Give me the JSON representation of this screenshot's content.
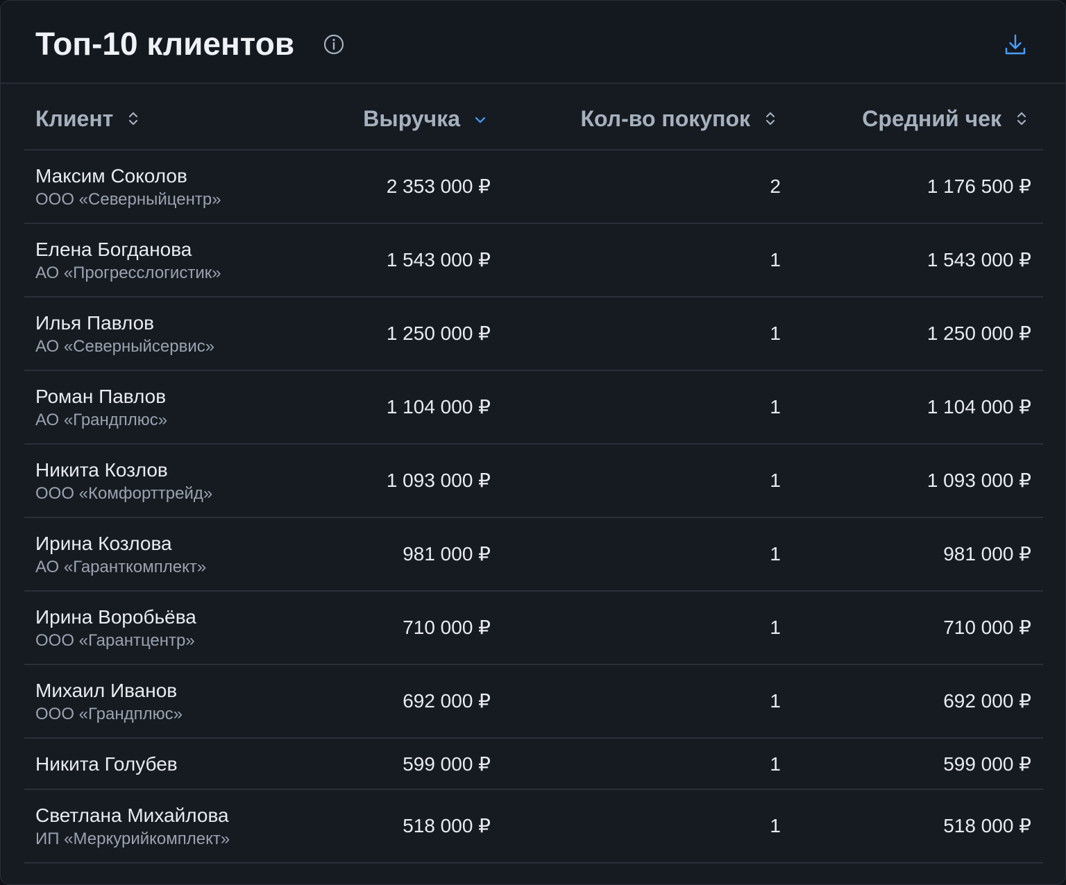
{
  "widget": {
    "title": "Топ-10 клиентов"
  },
  "columns": {
    "client": "Клиент",
    "revenue": "Выручка",
    "purchases": "Кол-во покупок",
    "avg_check": "Средний чек"
  },
  "sort": {
    "column": "revenue",
    "direction": "desc"
  },
  "rows": [
    {
      "name": "Максим Соколов",
      "company": "ООО «Северныйцентр»",
      "revenue": "2 353 000 ₽",
      "purchases": "2",
      "avg": "1 176 500 ₽"
    },
    {
      "name": "Елена Богданова",
      "company": "АО «Прогресслогистик»",
      "revenue": "1 543 000 ₽",
      "purchases": "1",
      "avg": "1 543 000 ₽"
    },
    {
      "name": "Илья Павлов",
      "company": "АО «Северныйсервис»",
      "revenue": "1 250 000 ₽",
      "purchases": "1",
      "avg": "1 250 000 ₽"
    },
    {
      "name": "Роман Павлов",
      "company": "АО «Грандплюс»",
      "revenue": "1 104 000 ₽",
      "purchases": "1",
      "avg": "1 104 000 ₽"
    },
    {
      "name": "Никита Козлов",
      "company": "ООО «Комфорттрейд»",
      "revenue": "1 093 000 ₽",
      "purchases": "1",
      "avg": "1 093 000 ₽"
    },
    {
      "name": "Ирина Козлова",
      "company": "АО «Гаранткомплект»",
      "revenue": "981 000 ₽",
      "purchases": "1",
      "avg": "981 000 ₽"
    },
    {
      "name": "Ирина Воробьёва",
      "company": "ООО «Гарантцентр»",
      "revenue": "710 000 ₽",
      "purchases": "1",
      "avg": "710 000 ₽"
    },
    {
      "name": "Михаил Иванов",
      "company": "ООО «Грандплюс»",
      "revenue": "692 000 ₽",
      "purchases": "1",
      "avg": "692 000 ₽"
    },
    {
      "name": "Никита Голубев",
      "company": "",
      "revenue": "599 000 ₽",
      "purchases": "1",
      "avg": "599 000 ₽"
    },
    {
      "name": "Светлана Михайлова",
      "company": "ИП «Меркурийкомплект»",
      "revenue": "518 000 ₽",
      "purchases": "1",
      "avg": "518 000 ₽"
    }
  ],
  "icons": {
    "info": "info-circle-icon",
    "download": "download-icon",
    "sort_both": "sort-updown-icon",
    "sort_desc": "chevron-down-icon"
  },
  "colors": {
    "background": "#161b22",
    "accent": "#4a9eff",
    "text": "#e8ebef",
    "muted": "#9aa3ae"
  }
}
